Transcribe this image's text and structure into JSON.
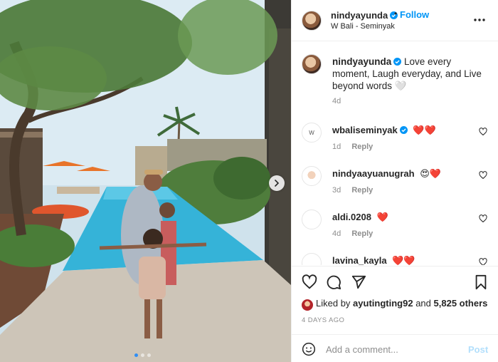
{
  "post": {
    "username": "nindyayunda",
    "follow_label": "Follow",
    "separator": "•",
    "location": "W Bali - Seminyak",
    "caption_username": "nindyayunda",
    "caption_text": "Love every moment, Laugh everyday, and Live beyond words 🤍",
    "caption_age": "4d"
  },
  "comments": [
    {
      "username": "wbaliseminyak",
      "verified": true,
      "text": "❤️❤️",
      "age": "1d",
      "reply_label": "Reply",
      "avatar_text": "W"
    },
    {
      "username": "nindyaayuanugrah",
      "verified": false,
      "text": "😍❤️",
      "age": "3d",
      "reply_label": "Reply",
      "avatar_text": ""
    },
    {
      "username": "aldi.0208",
      "verified": false,
      "text": "❤️",
      "age": "4d",
      "reply_label": "Reply",
      "avatar_text": ""
    },
    {
      "username": "lavina_kayla",
      "verified": false,
      "text": "❤️❤️",
      "age": "",
      "reply_label": "",
      "avatar_text": ""
    }
  ],
  "likes": {
    "prefix": "Liked by",
    "user": "ayutingting92",
    "conjunction": "and",
    "others": "5,825 others"
  },
  "posted_ago": "4 DAYS AGO",
  "add_comment": {
    "placeholder": "Add a comment...",
    "post_label": "Post"
  },
  "carousel": {
    "slide_count": 3,
    "active_index": 0
  },
  "colors": {
    "accent": "#0095f6",
    "post_disabled": "#b2dffc",
    "secondary_text": "#8e8e8e",
    "heart": "#ed4956"
  },
  "icons": [
    "heart-icon",
    "comment-icon",
    "share-icon",
    "bookmark-icon",
    "emoji-icon",
    "more-icon",
    "verified-icon",
    "chevron-right-icon"
  ]
}
